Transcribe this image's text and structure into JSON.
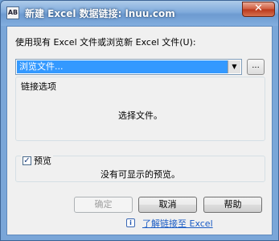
{
  "window": {
    "title": "新建 Excel 数据链接: lnuu.com",
    "icon_text": "AB",
    "close_glyph": "✕"
  },
  "source": {
    "label": "使用现有 Excel 文件或浏览新 Excel 文件(U):",
    "combo_value": "浏览文件...",
    "dropdown_icon": "▼",
    "browse_label": "..."
  },
  "link_options": {
    "label": "链接选项",
    "message": "选择文件。"
  },
  "preview": {
    "checkbox_mark": "✓",
    "label": "预览",
    "checked": true,
    "message": "没有可显示的预览。"
  },
  "buttons": {
    "ok": "确定",
    "cancel": "取消",
    "help": "帮助"
  },
  "footer": {
    "info_icon": "i",
    "link": "了解链接至 Excel"
  }
}
